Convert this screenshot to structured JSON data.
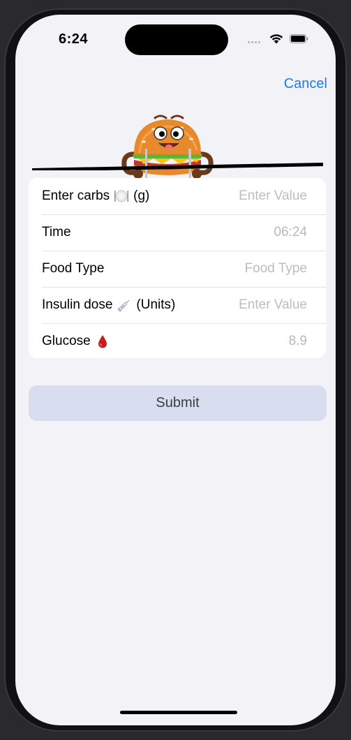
{
  "status_bar": {
    "time": "6:24"
  },
  "nav": {
    "cancel_label": "Cancel"
  },
  "form": {
    "rows": [
      {
        "label_prefix": "Enter carbs",
        "icon": "plate-icon",
        "label_suffix": "(g)",
        "value": "Enter Value",
        "is_placeholder": true
      },
      {
        "label_prefix": "Time",
        "icon": null,
        "label_suffix": "",
        "value": "06:24",
        "is_placeholder": false
      },
      {
        "label_prefix": "Food Type",
        "icon": null,
        "label_suffix": "",
        "value": "Food Type",
        "is_placeholder": true
      },
      {
        "label_prefix": "Insulin dose",
        "icon": "syringe-icon",
        "label_suffix": "(Units)",
        "value": "Enter Value",
        "is_placeholder": true
      },
      {
        "label_prefix": "Glucose",
        "icon": "blood-drop-icon",
        "label_suffix": "",
        "value": "8.9",
        "is_placeholder": false
      }
    ]
  },
  "actions": {
    "submit_label": "Submit"
  },
  "colors": {
    "accent": "#1a7cf5",
    "background": "#f2f2f7",
    "card": "#ffffff",
    "submit_bg": "#d8deef",
    "placeholder_text": "#bcbcc2"
  }
}
